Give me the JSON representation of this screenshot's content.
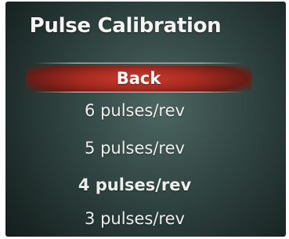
{
  "screen": {
    "title": "Pulse Calibration"
  },
  "menu": {
    "items": [
      {
        "label": "Back",
        "selected": true
      },
      {
        "label": "6 pulses/rev"
      },
      {
        "label": "5 pulses/rev"
      },
      {
        "label": "4 pulses/rev",
        "emphasized": true
      },
      {
        "label": "3 pulses/rev"
      }
    ]
  },
  "colors": {
    "background": "#2f4340",
    "selection": "#b8342a",
    "text": "#f2f2f0"
  }
}
